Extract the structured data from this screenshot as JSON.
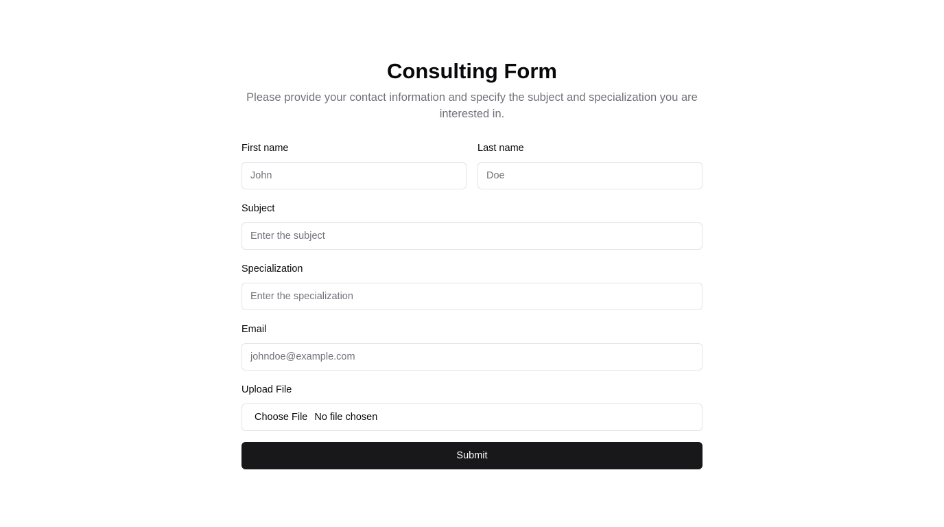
{
  "form": {
    "title": "Consulting Form",
    "description": "Please provide your contact information and specify the subject and specialization you are interested in.",
    "first_name": {
      "label": "First name",
      "placeholder": "John",
      "value": ""
    },
    "last_name": {
      "label": "Last name",
      "placeholder": "Doe",
      "value": ""
    },
    "subject": {
      "label": "Subject",
      "placeholder": "Enter the subject",
      "value": ""
    },
    "specialization": {
      "label": "Specialization",
      "placeholder": "Enter the specialization",
      "value": ""
    },
    "email": {
      "label": "Email",
      "placeholder": "johndoe@example.com",
      "value": ""
    },
    "upload": {
      "label": "Upload File",
      "button_label": "Choose File",
      "status": "No file chosen"
    },
    "submit_label": "Submit"
  },
  "colors": {
    "primary_button": "#18181b",
    "muted_text": "#71717a",
    "border": "#e4e4e7"
  }
}
